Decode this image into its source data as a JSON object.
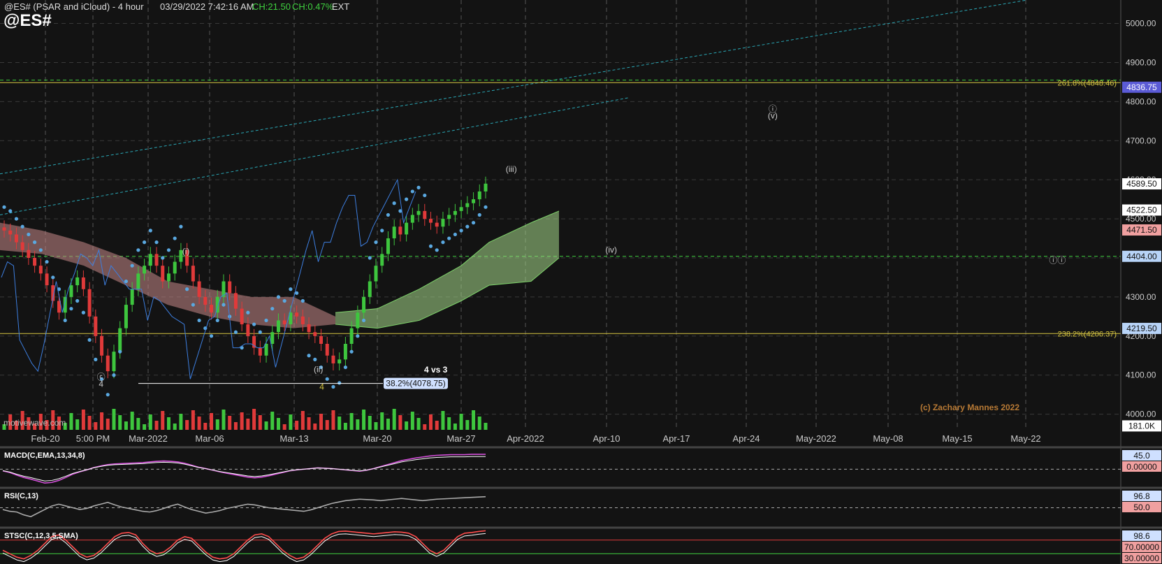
{
  "header": {
    "title": "@ES# (PSAR and iCloud) - 4 hour",
    "datetime": "03/29/2022 7:42:16 AM",
    "change_points": "CH:21.50",
    "change_pct": "CH:0.47%",
    "session": "EXT",
    "symbol": "@ES#",
    "watermark": "motivewave.com"
  },
  "colors": {
    "background": "#131313",
    "up": "#3ec63e",
    "down": "#e03a3a",
    "psar": "#5aa8e0",
    "cloud_bull": "#a6d98a",
    "cloud_bear": "#c98a8a",
    "fib": "#d6c542",
    "support": "#3fd13f",
    "trend": "#2aa7b5",
    "macd": "#d24fd8",
    "price_line": "#3d7fe0",
    "copyright": "#b87a35"
  },
  "chart_data": [
    {
      "type": "candlestick",
      "title": "@ES# (PSAR and iCloud) - 4 hour",
      "y_range": [
        3960,
        5060
      ],
      "y_ticks": [
        "5000.00",
        "4900.00",
        "4800.00",
        "4700.00",
        "4600.00",
        "4500.00",
        "4400.00",
        "4300.00",
        "4200.00",
        "4100.00",
        "4000.00"
      ],
      "x_ticks": [
        "Feb-20",
        "5:00 PM",
        "Mar-2022",
        "Mar-06",
        "Mar-13",
        "Mar-20",
        "Mar-27",
        "Apr-2022",
        "Apr-10",
        "Apr-17",
        "Apr-24",
        "May-2022",
        "May-08",
        "May-15",
        "May-22"
      ],
      "price_badges": [
        {
          "label": "4836.75",
          "value": 4836.75,
          "color": "#5b5bd6"
        },
        {
          "label": "4589.50",
          "value": 4589.5,
          "color": "#ffffff"
        },
        {
          "label": "4522.50",
          "value": 4522.5,
          "color": "#ffffff"
        },
        {
          "label": "4471.50",
          "value": 4471.5,
          "color": "#f0a0a0"
        },
        {
          "label": "4404.00",
          "value": 4404,
          "color": "#b8d4f8"
        },
        {
          "label": "4219.50",
          "value": 4219.5,
          "color": "#b8d4f8"
        },
        {
          "label": "181.0K",
          "value": 3970,
          "color": "#ffffff"
        }
      ],
      "fib_levels": [
        {
          "label": "261.8%(4848.46)",
          "value": 4848.46
        },
        {
          "label": "238.2%(4206.37)",
          "value": 4206.37
        }
      ],
      "support_level": 4404,
      "target_badge": {
        "label": "38.2%(4078.75)",
        "value": 4078.75
      },
      "wave_labels": [
        {
          "text": "(i)",
          "x": 0.16,
          "price": 4410
        },
        {
          "text": "(ii)",
          "x": 0.274,
          "price": 4108
        },
        {
          "text": "(iii)",
          "x": 0.44,
          "price": 4620
        },
        {
          "text": "(iv)",
          "x": 0.526,
          "price": 4413
        },
        {
          "text": "(v)",
          "x": 0.665,
          "price": 4757
        },
        {
          "text": "ⓘ",
          "x": 0.665,
          "price": 4774
        },
        {
          "text": "ⓘⓘ",
          "x": 0.91,
          "price": 4387
        },
        {
          "text": "ⓒ",
          "x": 0.087,
          "price": 4088
        },
        {
          "text": "4",
          "x": 0.087,
          "price": 4070
        },
        {
          "text": "4",
          "x": 0.277,
          "price": 4063
        },
        {
          "text": "4 vs 3",
          "x": 0.375,
          "price": 4107
        }
      ],
      "copyright": "(c) Zachary Mannes 2022",
      "closes": [
        4470,
        4460,
        4440,
        4420,
        4400,
        4380,
        4360,
        4330,
        4290,
        4260,
        4300,
        4330,
        4350,
        4320,
        4250,
        4200,
        4150,
        4110,
        4160,
        4220,
        4280,
        4320,
        4360,
        4380,
        4410,
        4380,
        4340,
        4360,
        4390,
        4420,
        4380,
        4340,
        4300,
        4280,
        4260,
        4300,
        4340,
        4310,
        4270,
        4230,
        4200,
        4170,
        4150,
        4180,
        4210,
        4240,
        4230,
        4260,
        4250,
        4230,
        4210,
        4200,
        4180,
        4150,
        4130,
        4140,
        4180,
        4220,
        4260,
        4300,
        4340,
        4380,
        4410,
        4450,
        4480,
        4460,
        4490,
        4510,
        4520,
        4500,
        4490,
        4480,
        4500,
        4510,
        4520,
        4530,
        4540,
        4550,
        4570,
        4590
      ]
    },
    {
      "type": "line",
      "title": "MACD(C,EMA,13,34,8)",
      "badges": [
        "45.0",
        "0.00000"
      ],
      "values": [
        -5,
        -10,
        -18,
        -25,
        -30,
        -36,
        -42,
        -40,
        -34,
        -25,
        -15,
        -8,
        -2,
        5,
        10,
        14,
        16,
        17,
        18,
        19,
        20,
        22,
        24,
        25,
        24,
        22,
        18,
        12,
        6,
        2,
        -3,
        -8,
        -12,
        -16,
        -20,
        -24,
        -26,
        -24,
        -20,
        -15,
        -10,
        -5,
        -2,
        0,
        2,
        4,
        3,
        2,
        0,
        -2,
        -4,
        -6,
        -3,
        2,
        8,
        14,
        20,
        26,
        30,
        34,
        37,
        40,
        42,
        43,
        44,
        44,
        44,
        45,
        45,
        45
      ]
    },
    {
      "type": "line",
      "title": "RSI(C,13)",
      "badges": [
        "96.8",
        "50.0"
      ],
      "values": [
        45,
        40,
        38,
        30,
        25,
        35,
        45,
        55,
        60,
        55,
        50,
        45,
        48,
        55,
        60,
        65,
        58,
        52,
        48,
        44,
        40,
        38,
        42,
        48,
        55,
        60,
        52,
        45,
        40,
        35,
        38,
        42,
        48,
        52,
        56,
        60,
        58,
        54,
        50,
        48,
        46,
        44,
        42,
        40,
        44,
        50,
        56,
        62,
        66,
        70,
        72,
        74,
        73,
        72,
        70,
        72,
        74,
        76,
        74,
        72,
        70,
        72,
        74,
        75,
        76,
        77,
        78,
        79,
        80,
        81
      ]
    },
    {
      "type": "line",
      "title": "STSC(C,12,3,5,SMA)",
      "badges": [
        "98.6",
        "70.00000",
        "30.00000"
      ],
      "values": [
        40,
        30,
        20,
        15,
        25,
        40,
        60,
        80,
        85,
        70,
        50,
        30,
        20,
        25,
        40,
        60,
        80,
        90,
        92,
        85,
        60,
        40,
        30,
        35,
        50,
        70,
        80,
        75,
        55,
        35,
        20,
        15,
        18,
        30,
        50,
        70,
        85,
        88,
        80,
        60,
        40,
        25,
        15,
        20,
        35,
        55,
        75,
        88,
        95,
        96,
        94,
        92,
        90,
        88,
        90,
        92,
        94,
        93,
        90,
        80,
        60,
        40,
        30,
        40,
        60,
        80,
        90,
        92,
        95,
        97
      ]
    }
  ]
}
